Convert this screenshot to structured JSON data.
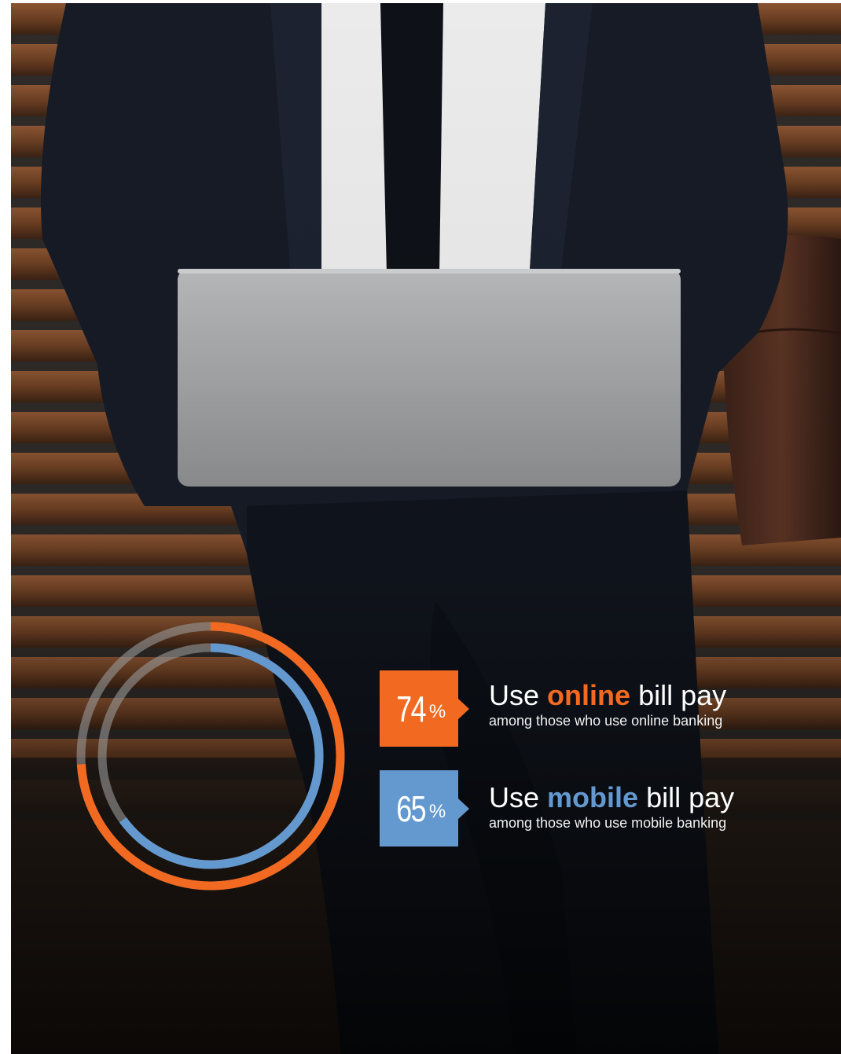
{
  "chart_data": {
    "type": "donut",
    "series": [
      {
        "value": 74,
        "value_label": "74",
        "unit": "%",
        "headline_pre": "Use",
        "headline_keyword": "online",
        "headline_post": "bill pay",
        "subtitle": "among those who use online banking",
        "color": "#f26a21"
      },
      {
        "value": 65,
        "value_label": "65",
        "unit": "%",
        "headline_pre": "Use",
        "headline_keyword": "mobile",
        "headline_post": "bill pay",
        "subtitle": "among those who use mobile banking",
        "color": "#6499cf"
      }
    ],
    "track_color": "#9a9a9a",
    "max": 100
  },
  "background": {
    "subject": "person in dark suit with laptop on wooden bench",
    "palette": {
      "bench": "#7a4a2a",
      "suit": "#151a24",
      "shirt": "#ececec",
      "laptop": "#a9aaab"
    }
  }
}
